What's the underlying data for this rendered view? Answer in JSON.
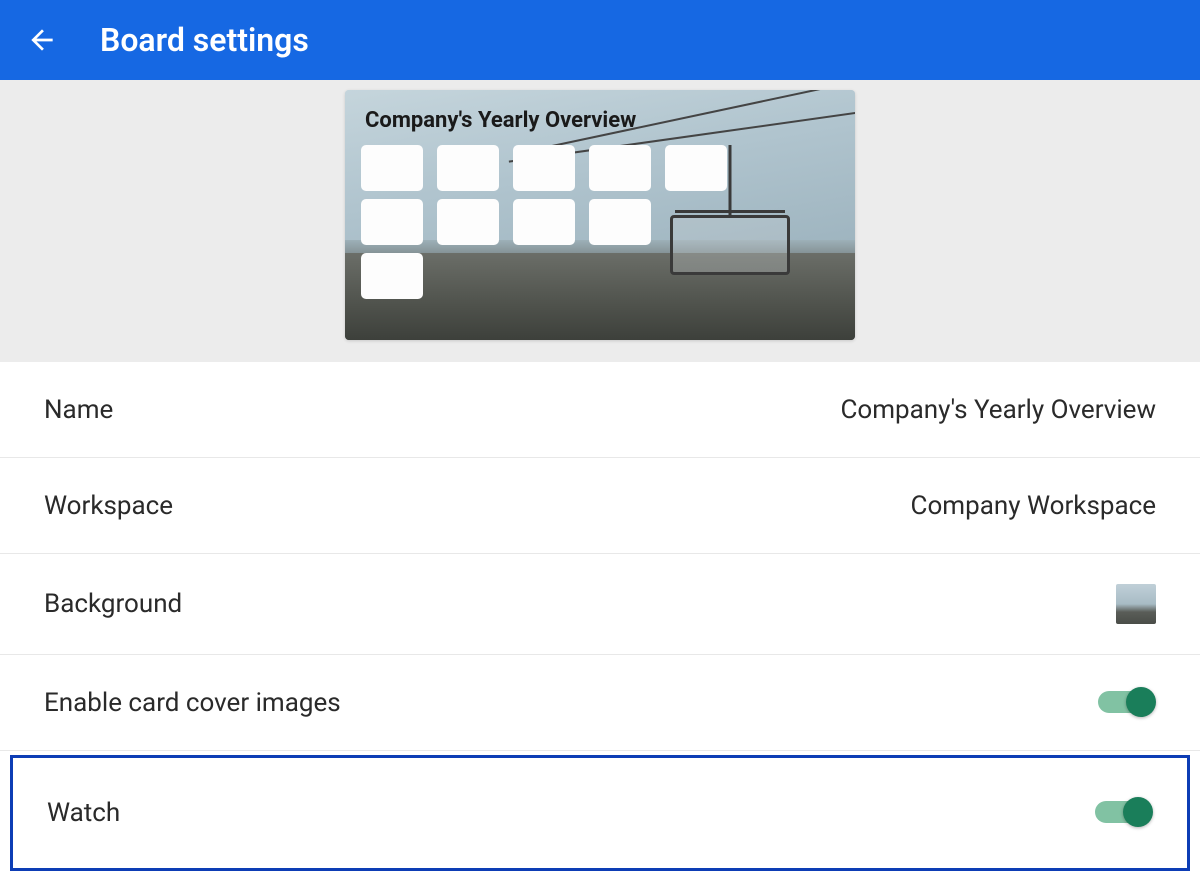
{
  "header": {
    "title": "Board settings"
  },
  "preview": {
    "board_title": "Company's Yearly Overview"
  },
  "settings": {
    "name": {
      "label": "Name",
      "value": "Company's Yearly Overview"
    },
    "workspace": {
      "label": "Workspace",
      "value": "Company Workspace"
    },
    "background": {
      "label": "Background"
    },
    "card_cover": {
      "label": "Enable card cover images",
      "enabled": true
    },
    "watch": {
      "label": "Watch",
      "enabled": true
    }
  },
  "colors": {
    "header_bg": "#1668e3",
    "toggle_on": "#1a7e5a",
    "highlight_border": "#0d3db5"
  }
}
